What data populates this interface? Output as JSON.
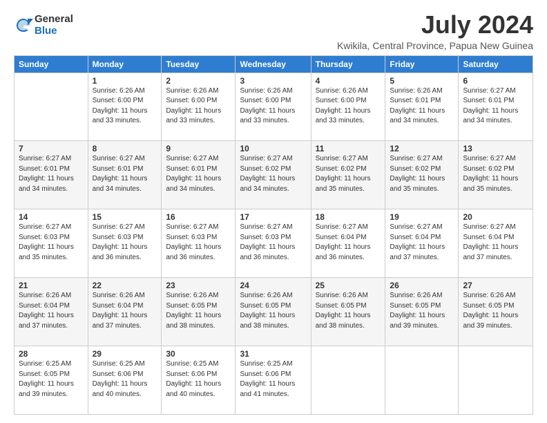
{
  "logo": {
    "general": "General",
    "blue": "Blue"
  },
  "title": {
    "month_year": "July 2024",
    "location": "Kwikila, Central Province, Papua New Guinea"
  },
  "headers": [
    "Sunday",
    "Monday",
    "Tuesday",
    "Wednesday",
    "Thursday",
    "Friday",
    "Saturday"
  ],
  "weeks": [
    [
      {
        "day": "",
        "info": ""
      },
      {
        "day": "1",
        "info": "Sunrise: 6:26 AM\nSunset: 6:00 PM\nDaylight: 11 hours\nand 33 minutes."
      },
      {
        "day": "2",
        "info": "Sunrise: 6:26 AM\nSunset: 6:00 PM\nDaylight: 11 hours\nand 33 minutes."
      },
      {
        "day": "3",
        "info": "Sunrise: 6:26 AM\nSunset: 6:00 PM\nDaylight: 11 hours\nand 33 minutes."
      },
      {
        "day": "4",
        "info": "Sunrise: 6:26 AM\nSunset: 6:00 PM\nDaylight: 11 hours\nand 33 minutes."
      },
      {
        "day": "5",
        "info": "Sunrise: 6:26 AM\nSunset: 6:01 PM\nDaylight: 11 hours\nand 34 minutes."
      },
      {
        "day": "6",
        "info": "Sunrise: 6:27 AM\nSunset: 6:01 PM\nDaylight: 11 hours\nand 34 minutes."
      }
    ],
    [
      {
        "day": "7",
        "info": "Sunrise: 6:27 AM\nSunset: 6:01 PM\nDaylight: 11 hours\nand 34 minutes."
      },
      {
        "day": "8",
        "info": "Sunrise: 6:27 AM\nSunset: 6:01 PM\nDaylight: 11 hours\nand 34 minutes."
      },
      {
        "day": "9",
        "info": "Sunrise: 6:27 AM\nSunset: 6:01 PM\nDaylight: 11 hours\nand 34 minutes."
      },
      {
        "day": "10",
        "info": "Sunrise: 6:27 AM\nSunset: 6:02 PM\nDaylight: 11 hours\nand 34 minutes."
      },
      {
        "day": "11",
        "info": "Sunrise: 6:27 AM\nSunset: 6:02 PM\nDaylight: 11 hours\nand 35 minutes."
      },
      {
        "day": "12",
        "info": "Sunrise: 6:27 AM\nSunset: 6:02 PM\nDaylight: 11 hours\nand 35 minutes."
      },
      {
        "day": "13",
        "info": "Sunrise: 6:27 AM\nSunset: 6:02 PM\nDaylight: 11 hours\nand 35 minutes."
      }
    ],
    [
      {
        "day": "14",
        "info": "Sunrise: 6:27 AM\nSunset: 6:03 PM\nDaylight: 11 hours\nand 35 minutes."
      },
      {
        "day": "15",
        "info": "Sunrise: 6:27 AM\nSunset: 6:03 PM\nDaylight: 11 hours\nand 36 minutes."
      },
      {
        "day": "16",
        "info": "Sunrise: 6:27 AM\nSunset: 6:03 PM\nDaylight: 11 hours\nand 36 minutes."
      },
      {
        "day": "17",
        "info": "Sunrise: 6:27 AM\nSunset: 6:03 PM\nDaylight: 11 hours\nand 36 minutes."
      },
      {
        "day": "18",
        "info": "Sunrise: 6:27 AM\nSunset: 6:04 PM\nDaylight: 11 hours\nand 36 minutes."
      },
      {
        "day": "19",
        "info": "Sunrise: 6:27 AM\nSunset: 6:04 PM\nDaylight: 11 hours\nand 37 minutes."
      },
      {
        "day": "20",
        "info": "Sunrise: 6:27 AM\nSunset: 6:04 PM\nDaylight: 11 hours\nand 37 minutes."
      }
    ],
    [
      {
        "day": "21",
        "info": "Sunrise: 6:26 AM\nSunset: 6:04 PM\nDaylight: 11 hours\nand 37 minutes."
      },
      {
        "day": "22",
        "info": "Sunrise: 6:26 AM\nSunset: 6:04 PM\nDaylight: 11 hours\nand 37 minutes."
      },
      {
        "day": "23",
        "info": "Sunrise: 6:26 AM\nSunset: 6:05 PM\nDaylight: 11 hours\nand 38 minutes."
      },
      {
        "day": "24",
        "info": "Sunrise: 6:26 AM\nSunset: 6:05 PM\nDaylight: 11 hours\nand 38 minutes."
      },
      {
        "day": "25",
        "info": "Sunrise: 6:26 AM\nSunset: 6:05 PM\nDaylight: 11 hours\nand 38 minutes."
      },
      {
        "day": "26",
        "info": "Sunrise: 6:26 AM\nSunset: 6:05 PM\nDaylight: 11 hours\nand 39 minutes."
      },
      {
        "day": "27",
        "info": "Sunrise: 6:26 AM\nSunset: 6:05 PM\nDaylight: 11 hours\nand 39 minutes."
      }
    ],
    [
      {
        "day": "28",
        "info": "Sunrise: 6:25 AM\nSunset: 6:05 PM\nDaylight: 11 hours\nand 39 minutes."
      },
      {
        "day": "29",
        "info": "Sunrise: 6:25 AM\nSunset: 6:06 PM\nDaylight: 11 hours\nand 40 minutes."
      },
      {
        "day": "30",
        "info": "Sunrise: 6:25 AM\nSunset: 6:06 PM\nDaylight: 11 hours\nand 40 minutes."
      },
      {
        "day": "31",
        "info": "Sunrise: 6:25 AM\nSunset: 6:06 PM\nDaylight: 11 hours\nand 41 minutes."
      },
      {
        "day": "",
        "info": ""
      },
      {
        "day": "",
        "info": ""
      },
      {
        "day": "",
        "info": ""
      }
    ]
  ]
}
